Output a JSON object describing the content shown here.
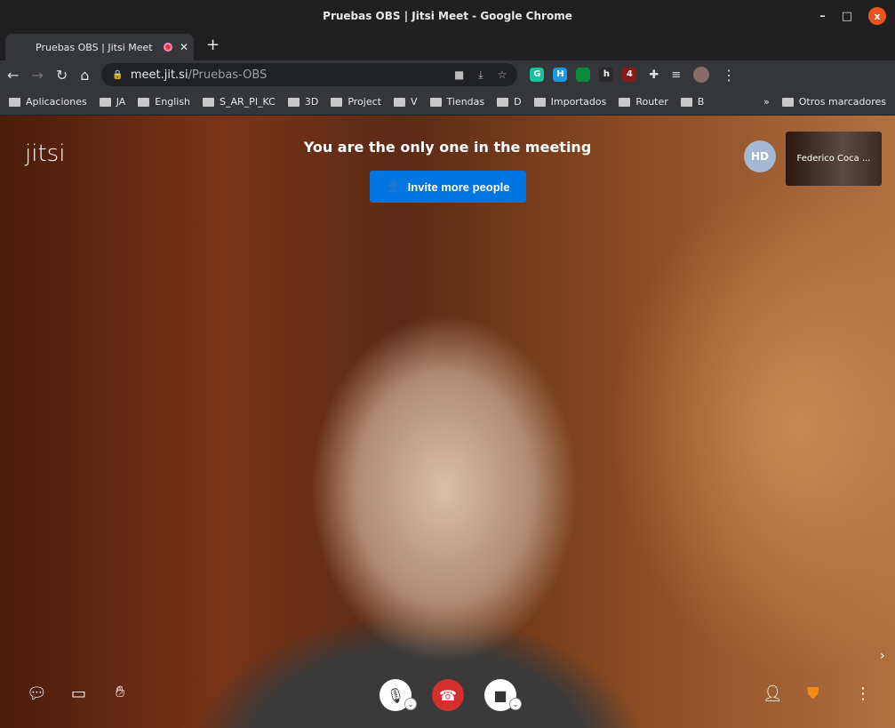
{
  "window": {
    "title": "Pruebas OBS | Jitsi Meet - Google Chrome"
  },
  "tab": {
    "title": "Pruebas OBS | Jitsi Meet"
  },
  "omnibox": {
    "host": "meet.jit.si",
    "path": "/Pruebas-OBS"
  },
  "extensions": [
    {
      "label": "G",
      "color": "#15c39a"
    },
    {
      "label": "H",
      "color": "#1a9ae0"
    },
    {
      "label": "",
      "color": "#0a8a3a"
    },
    {
      "label": "h",
      "color": "#2a2a2a"
    },
    {
      "label": "4",
      "color": "#8a1a1a"
    }
  ],
  "bookmarks": [
    "Aplicaciones",
    "JA",
    "English",
    "S_AR_PI_KC",
    "3D",
    "Project",
    "V",
    "Tiendas",
    "D",
    "Importados",
    "Router",
    "B"
  ],
  "bookmarks_other": "Otros marcadores",
  "meeting": {
    "logo": "jitsi",
    "message": "You are the only one in the meeting",
    "invite_label": "Invite more people",
    "avatar_initials": "HD",
    "thumbnail_name": "Federico Coca ..."
  },
  "colors": {
    "accent": "#0074e0",
    "hangup": "#d32f2f",
    "shield": "#f28c13"
  }
}
